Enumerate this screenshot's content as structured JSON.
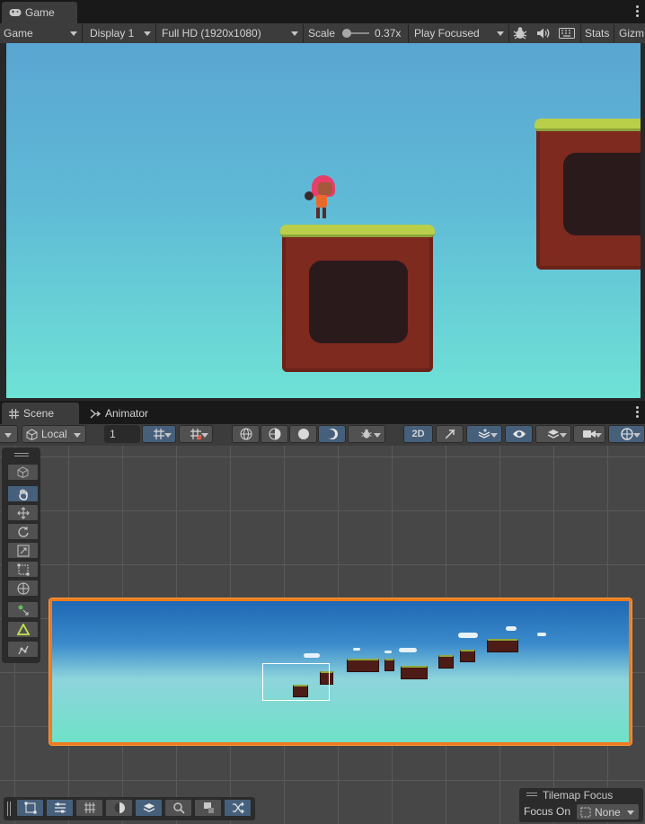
{
  "game_panel": {
    "tab_label": "Game",
    "menu_icon": "kebab-menu-icon",
    "toolbar": {
      "view_select": "Game",
      "display_select": "Display 1",
      "resolution_select": "Full HD (1920x1080)",
      "scale_label": "Scale",
      "scale_value": "0.37x",
      "play_mode_select": "Play Focused",
      "stats_label": "Stats",
      "gizmos_label": "Gizm"
    }
  },
  "scene_panel": {
    "tabs": [
      {
        "label": "Scene",
        "icon": "grid-icon",
        "active": true
      },
      {
        "label": "Animator",
        "icon": "animator-icon",
        "active": false
      }
    ],
    "toolbar": {
      "pivot_space_select": "Local",
      "grid_snap_value": "1",
      "mode_2d_label": "2D"
    },
    "tilemap_focus": {
      "title": "Tilemap Focus",
      "focus_on_label": "Focus On",
      "focus_on_value": "None"
    }
  },
  "colors": {
    "editor_bg": "#282828",
    "toolbar_bg": "#3c3c3c",
    "selected_tool": "#46607c",
    "selection_outline": "#f07a1e",
    "sky_top": "#5aa6d2",
    "sky_bottom": "#6fe2d6"
  }
}
